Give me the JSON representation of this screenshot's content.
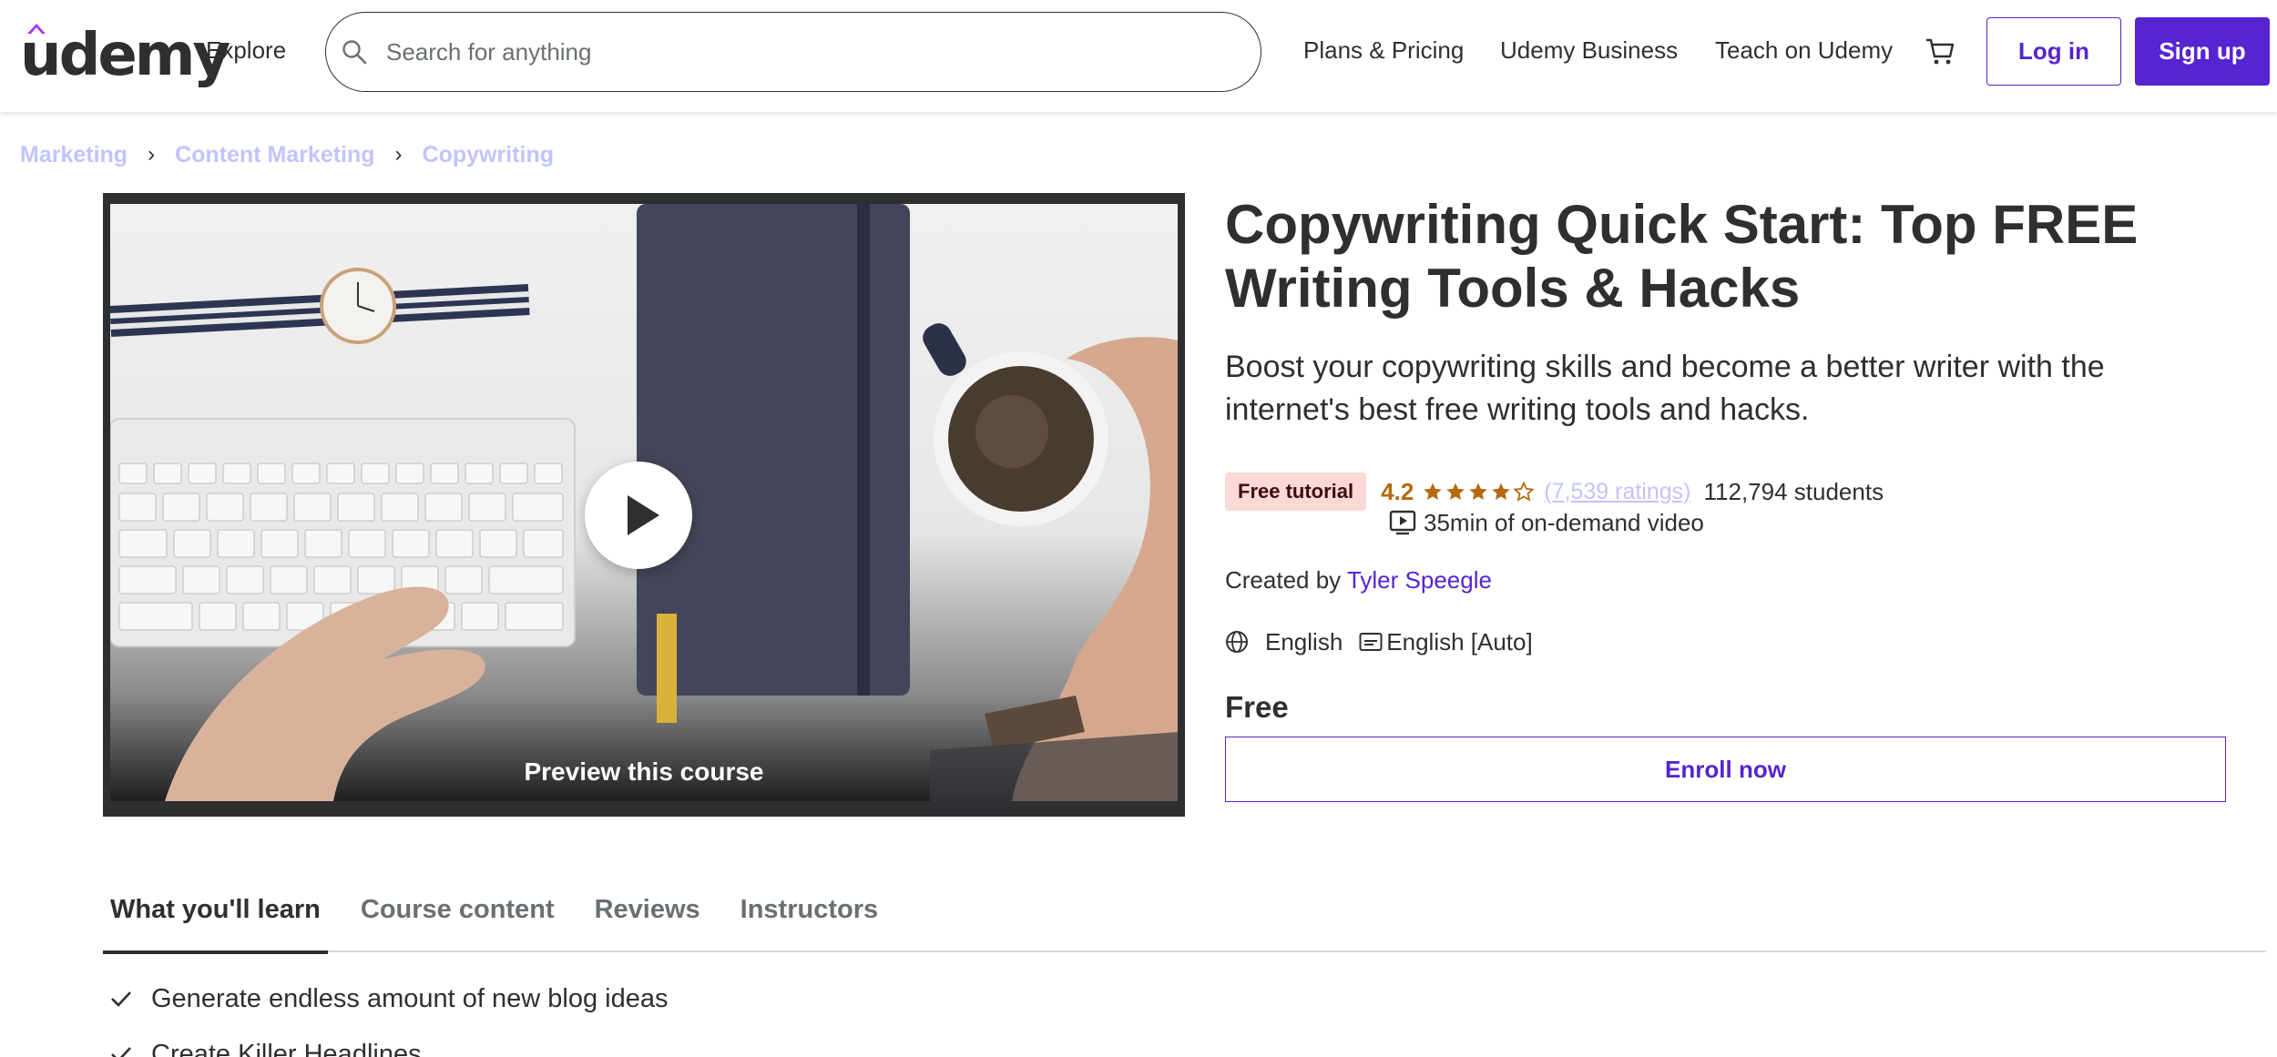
{
  "header": {
    "logo_text": "udemy",
    "explore": "Explore",
    "search_placeholder": "Search for anything",
    "links": [
      "Plans & Pricing",
      "Udemy Business",
      "Teach on Udemy"
    ],
    "login": "Log in",
    "signup": "Sign up",
    "brand_color": "#5624d0"
  },
  "breadcrumb": [
    "Marketing",
    "Content Marketing",
    "Copywriting"
  ],
  "preview": {
    "label": "Preview this course"
  },
  "course": {
    "title": "Copywriting Quick Start: Top FREE Writing Tools & Hacks",
    "subtitle": "Boost your copywriting skills and become a better writer with the internet's best free writing tools and hacks.",
    "badge": "Free tutorial",
    "rating": "4.2",
    "rating_value": 4.2,
    "ratings_count": "(7,539 ratings)",
    "students": "112,794 students",
    "video_length": "35min of on-demand video",
    "created_by_label": "Created by",
    "author": "Tyler Speegle",
    "language": "English",
    "captions": "English [Auto]",
    "price": "Free",
    "enroll": "Enroll now"
  },
  "tabs": [
    {
      "label": "What you'll learn",
      "active": true
    },
    {
      "label": "Course content",
      "active": false
    },
    {
      "label": "Reviews",
      "active": false
    },
    {
      "label": "Instructors",
      "active": false
    }
  ],
  "learn": [
    "Generate endless amount of new blog ideas",
    "Create Killer Headlines"
  ]
}
